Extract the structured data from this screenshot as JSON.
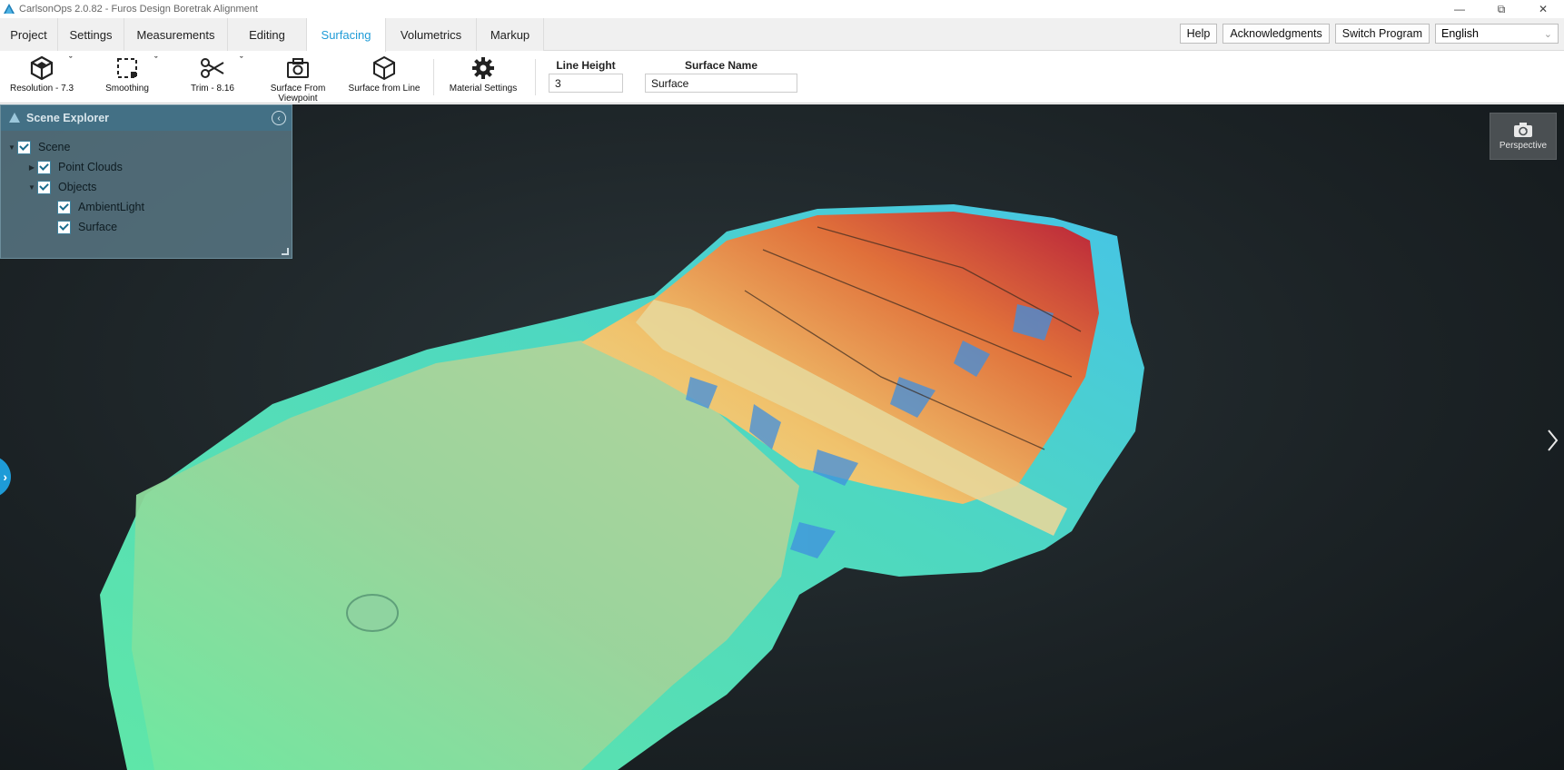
{
  "window": {
    "title": "CarlsonOps 2.0.82 - Furos Design Boretrak Alignment",
    "minimize": "—",
    "restore": "⧉",
    "close": "✕"
  },
  "tabs": [
    {
      "label": "Project"
    },
    {
      "label": "Settings"
    },
    {
      "label": "Measurements"
    },
    {
      "label": "Editing"
    },
    {
      "label": "Surfacing",
      "active": true
    },
    {
      "label": "Volumetrics"
    },
    {
      "label": "Markup"
    }
  ],
  "header_buttons": {
    "help": "Help",
    "acknowledgments": "Acknowledgments",
    "switch_program": "Switch Program",
    "language": "English"
  },
  "toolbar": {
    "resolution": "Resolution - 7.3",
    "smoothing": "Smoothing",
    "trim": "Trim - 8.16",
    "surface_from_viewpoint_1": "Surface From",
    "surface_from_viewpoint_2": "Viewpoint",
    "surface_from_line": "Surface from Line",
    "material_settings": "Material Settings",
    "line_height_label": "Line Height",
    "line_height_value": "3",
    "surface_name_label": "Surface Name",
    "surface_name_value": "Surface"
  },
  "explorer": {
    "title": "Scene Explorer",
    "items": [
      {
        "label": "Scene",
        "level": 0,
        "expanded": true,
        "checked": true
      },
      {
        "label": "Point Clouds",
        "level": 1,
        "expanded": false,
        "checked": true
      },
      {
        "label": "Objects",
        "level": 1,
        "expanded": true,
        "checked": true
      },
      {
        "label": "AmbientLight",
        "level": 2,
        "checked": true
      },
      {
        "label": "Surface",
        "level": 2,
        "checked": true
      }
    ]
  },
  "viewport": {
    "perspective_label": "Perspective",
    "left_nav": "›"
  },
  "colors": {
    "accent": "#1e9bd7",
    "viewport_bg": "#1c2326"
  }
}
